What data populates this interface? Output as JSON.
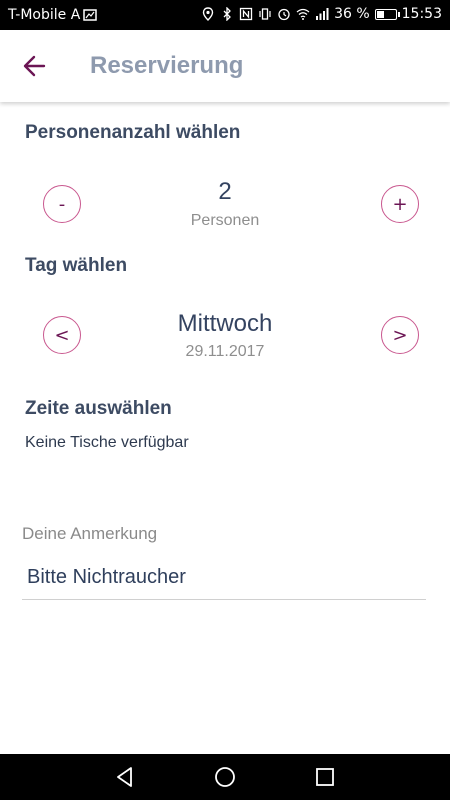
{
  "status_bar": {
    "carrier": "T-Mobile A",
    "battery_percent": "36 %",
    "battery_level": 0.36,
    "time": "15:53"
  },
  "app_bar": {
    "title": "Reservierung"
  },
  "persons": {
    "section_title": "Personenanzahl wählen",
    "decrement_label": "-",
    "increment_label": "+",
    "count": "2",
    "unit_label": "Personen"
  },
  "day": {
    "section_title": "Tag wählen",
    "prev_label": "<",
    "next_label": ">",
    "weekday": "Mittwoch",
    "date": "29.11.2017"
  },
  "time_slots": {
    "section_title": "Zeite auswählen",
    "message": "Keine Tische verfügbar"
  },
  "note": {
    "label": "Deine Anmerkung",
    "value": "Bitte Nichtraucher"
  },
  "colors": {
    "accent": "#6b1554",
    "button_border": "#c9588f",
    "title": "#8e9aae",
    "heading": "#3d4b63"
  }
}
